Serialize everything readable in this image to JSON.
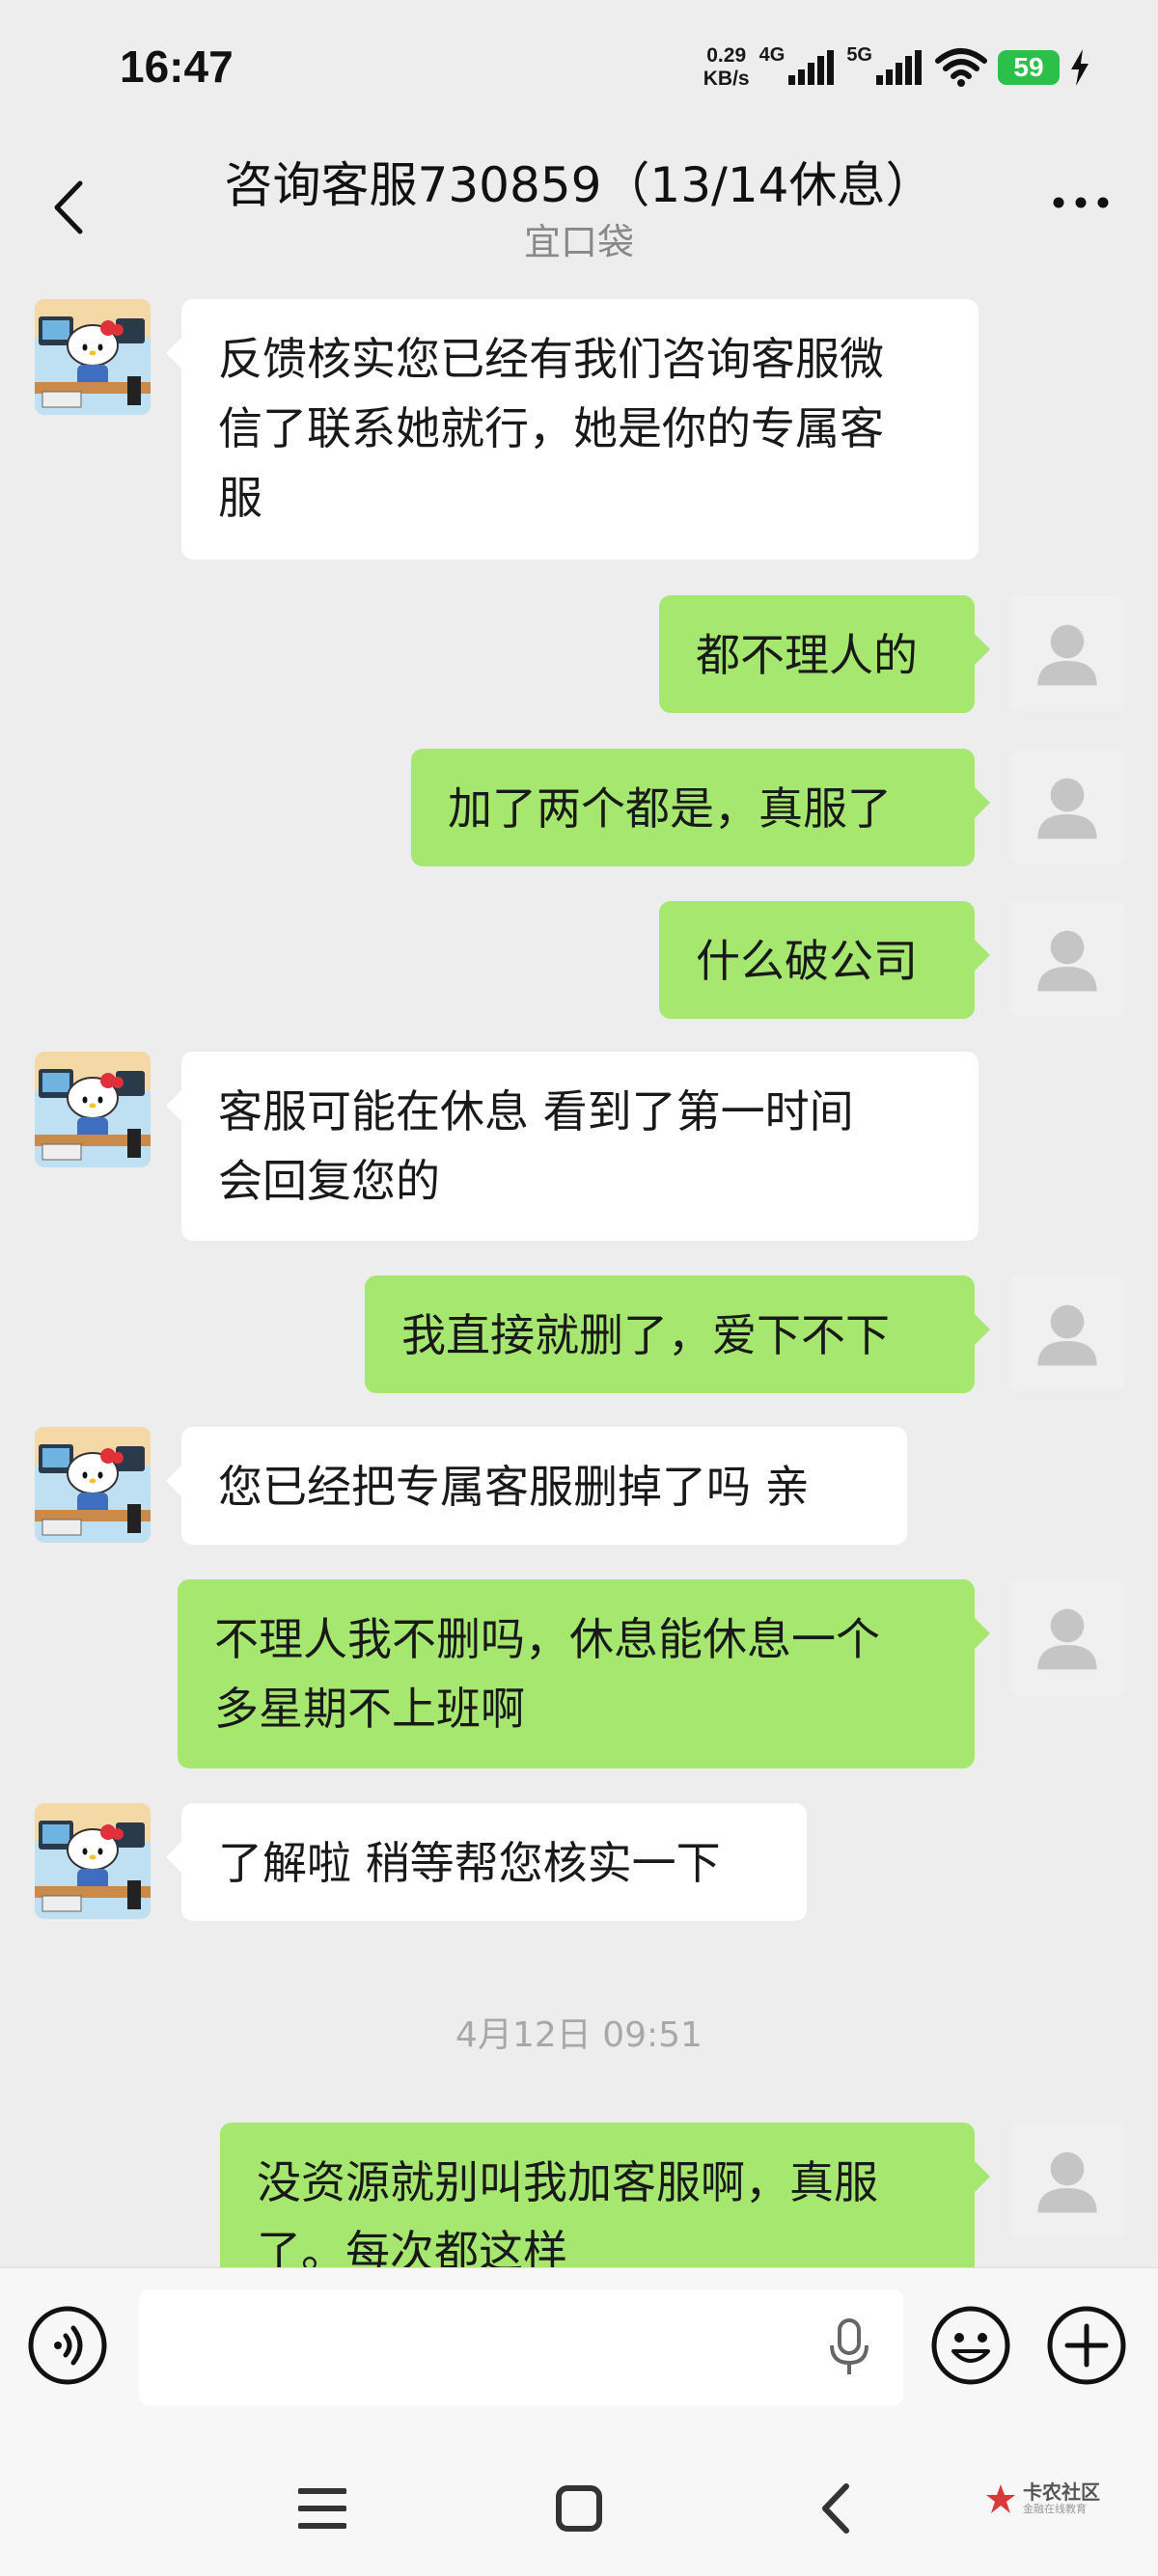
{
  "status_bar": {
    "time": "16:47",
    "net_speed_value": "0.29",
    "net_speed_unit": "KB/s",
    "sig1_label": "4G",
    "sig2_label": "5G",
    "battery": "59"
  },
  "header": {
    "title": "咨询客服730859（13/14休息）",
    "subtitle": "宜口袋"
  },
  "messages": [
    {
      "side": "in",
      "lines": [
        "反馈核实您已经有我们咨询客服微",
        "信了联系她就行，她是你的专属客",
        "服"
      ]
    },
    {
      "side": "out",
      "lines": [
        "都不理人的"
      ]
    },
    {
      "side": "out",
      "lines": [
        "加了两个都是，真服了"
      ]
    },
    {
      "side": "out",
      "lines": [
        "什么破公司"
      ]
    },
    {
      "side": "in",
      "lines": [
        "客服可能在休息 看到了第一时间",
        "会回复您的"
      ]
    },
    {
      "side": "out",
      "lines": [
        "我直接就删了，爱下不下"
      ]
    },
    {
      "side": "in",
      "lines": [
        "您已经把专属客服删掉了吗 亲"
      ]
    },
    {
      "side": "out",
      "lines": [
        "不理人我不删吗，休息能休息一个",
        "多星期不上班啊"
      ]
    },
    {
      "side": "in",
      "lines": [
        "了解啦 稍等帮您核实一下"
      ]
    },
    {
      "side": "out",
      "lines": [
        "没资源就别叫我加客服啊，真服",
        "了。每次都这样"
      ]
    }
  ],
  "timestamp": "4月12日 09:51",
  "input_bar": {
    "placeholder": ""
  },
  "watermark": {
    "name": "卡农社区",
    "sub": "金融在线教育"
  },
  "colors": {
    "in_bubble": "#ffffff",
    "out_bubble": "#a6e86f",
    "background": "#ededed",
    "battery": "#2cc04b"
  }
}
